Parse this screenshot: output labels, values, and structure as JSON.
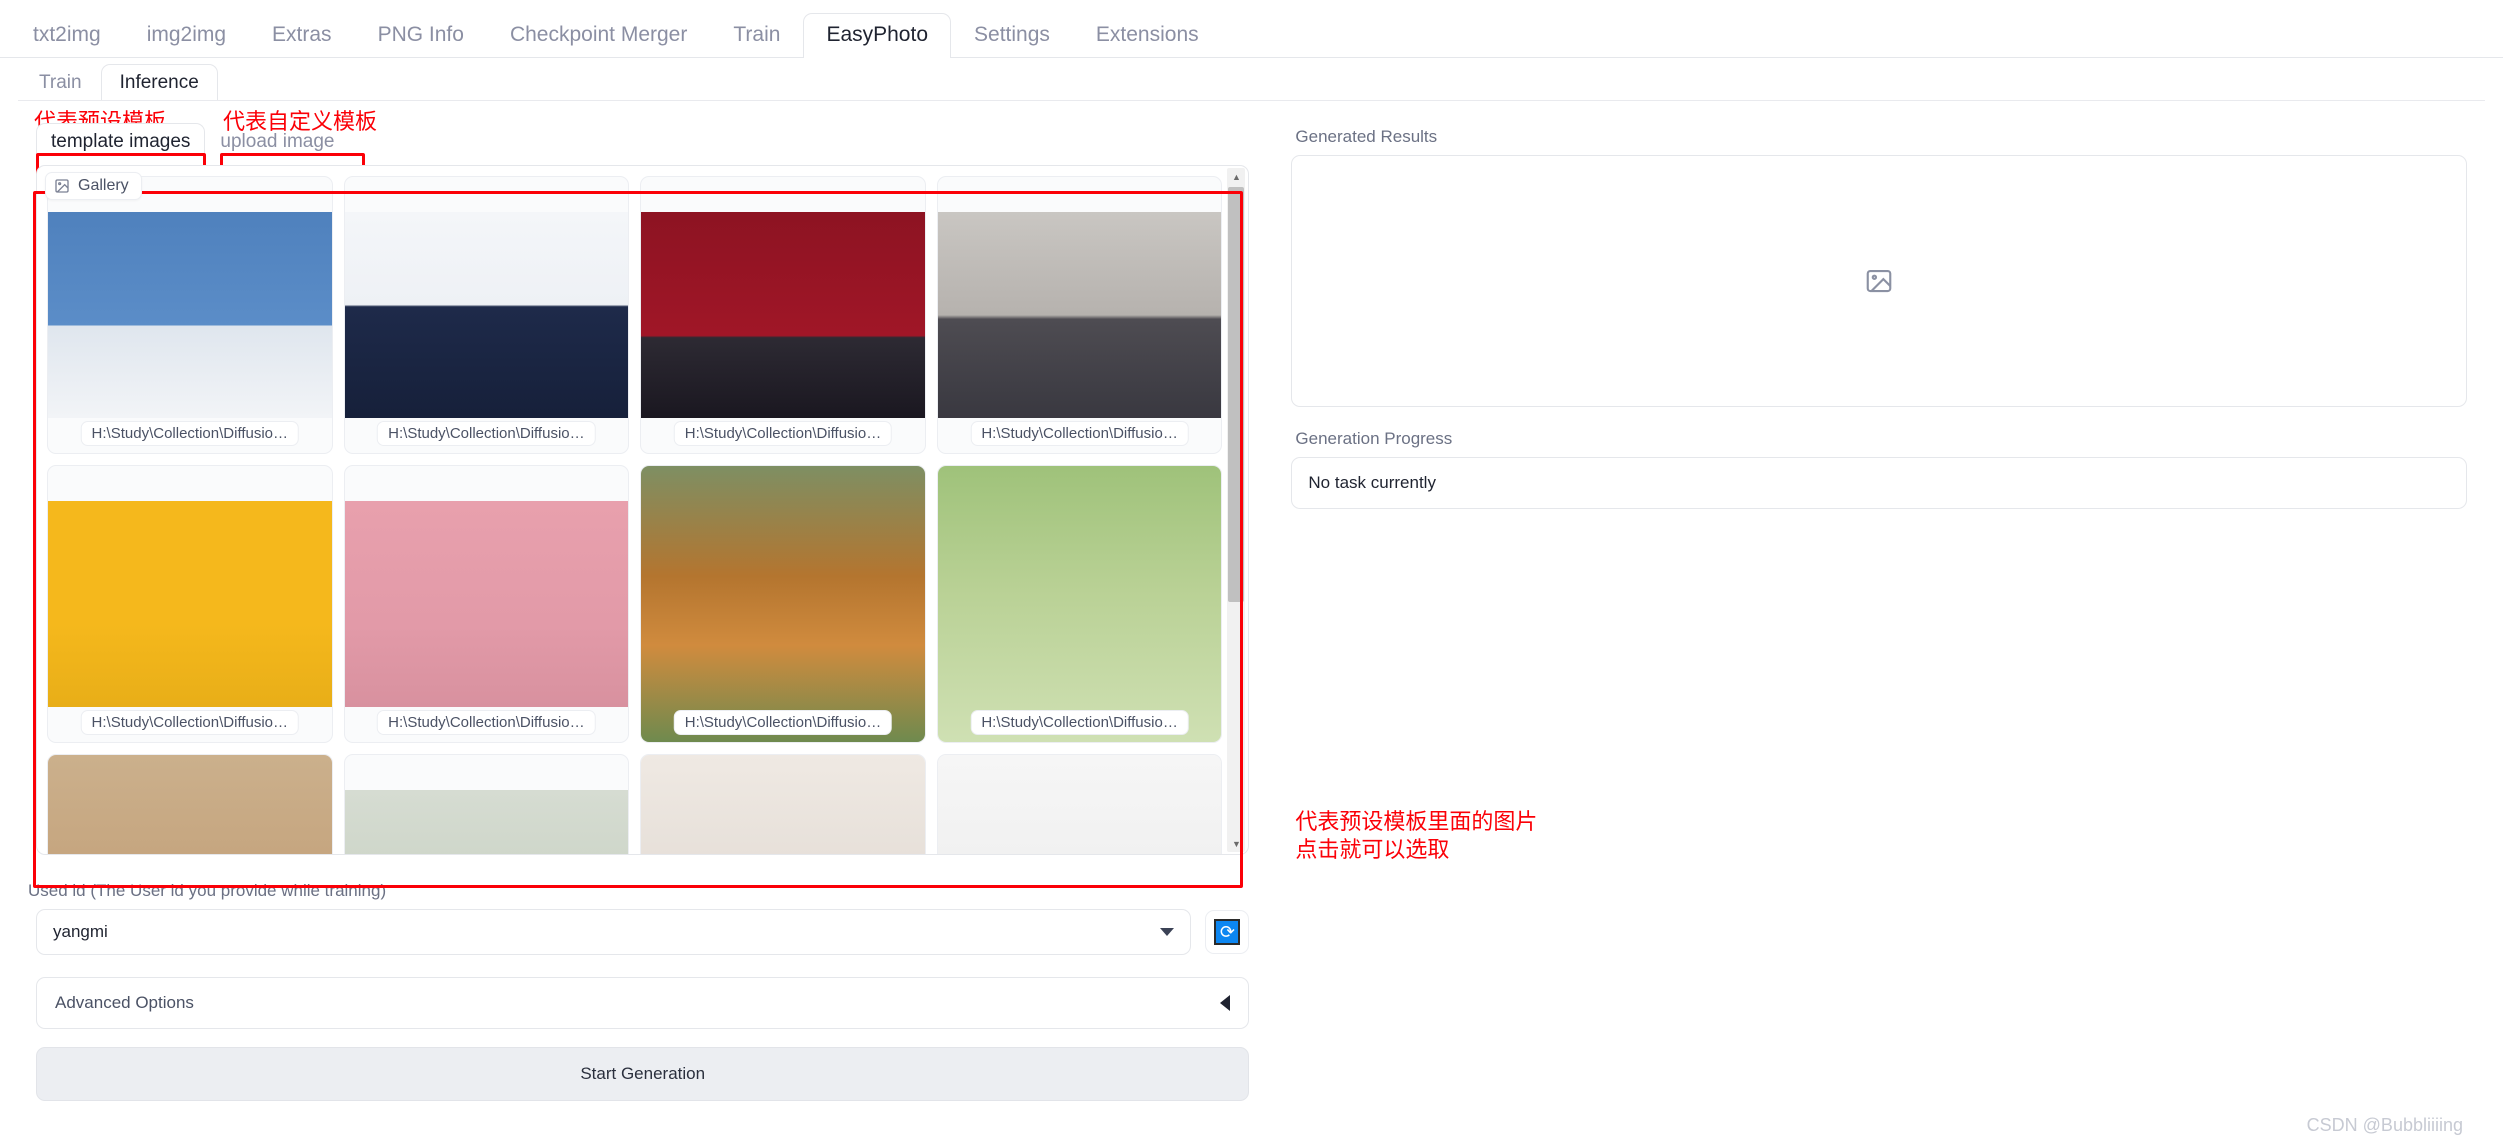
{
  "top_tabs": [
    {
      "label": "txt2img",
      "active": false
    },
    {
      "label": "img2img",
      "active": false
    },
    {
      "label": "Extras",
      "active": false
    },
    {
      "label": "PNG Info",
      "active": false
    },
    {
      "label": "Checkpoint Merger",
      "active": false
    },
    {
      "label": "Train",
      "active": false
    },
    {
      "label": "EasyPhoto",
      "active": true
    },
    {
      "label": "Settings",
      "active": false
    },
    {
      "label": "Extensions",
      "active": false
    }
  ],
  "sub_tabs": [
    {
      "label": "Train",
      "active": false
    },
    {
      "label": "Inference",
      "active": true
    }
  ],
  "template_tabs": [
    {
      "label": "template images",
      "active": true
    },
    {
      "label": "upload image",
      "active": false
    }
  ],
  "annotations": {
    "preset_template": "代表预设模板",
    "custom_template": "代表自定义模板",
    "gallery_note": "代表预设模板里面的图片\n点击就可以选取"
  },
  "gallery": {
    "badge_label": "Gallery",
    "badge_icon": "image-icon",
    "caption": "H:\\Study\\Collection\\Diffusio…",
    "items": [
      {
        "caption": "H:\\Study\\Collection\\Diffusio…",
        "style": "bg-blue-male"
      },
      {
        "caption": "H:\\Study\\Collection\\Diffusio…",
        "style": "bg-white-suit"
      },
      {
        "caption": "H:\\Study\\Collection\\Diffusio…",
        "style": "bg-red-girl"
      },
      {
        "caption": "H:\\Study\\Collection\\Diffusio…",
        "style": "bg-gray-uniform"
      },
      {
        "caption": "H:\\Study\\Collection\\Diffusio…",
        "style": "bg-yellow-hat"
      },
      {
        "caption": "H:\\Study\\Collection\\Diffusio…",
        "style": "bg-pink-dress"
      },
      {
        "caption": "H:\\Study\\Collection\\Diffusio…",
        "style": "bg-green-redhair"
      },
      {
        "caption": "H:\\Study\\Collection\\Diffusio…",
        "style": "bg-green-flower"
      },
      {
        "caption": "",
        "style": "bg-room-girl"
      },
      {
        "caption": "",
        "style": "bg-garden-girl"
      },
      {
        "caption": "",
        "style": "bg-white-longhair"
      },
      {
        "caption": "",
        "style": "bg-white-man"
      }
    ],
    "scrollbar": {
      "up_arrow": "▲",
      "down_arrow": "▼"
    }
  },
  "user_id": {
    "label": "Used id (The User id you provide while training)",
    "value": "yangmi",
    "refresh_icon": "refresh-icon",
    "refresh_glyph": "⟳"
  },
  "advanced": {
    "label": "Advanced Options",
    "caret": "caret-left-icon"
  },
  "start_button": {
    "label": "Start Generation"
  },
  "results": {
    "label": "Generated Results",
    "placeholder_icon": "image-placeholder-icon"
  },
  "progress": {
    "label": "Generation Progress",
    "value": "No task currently"
  },
  "watermark": "CSDN @Bubbliiiing",
  "colors": {
    "annotation_red": "#fb0007",
    "accent_blue": "#0c86f1",
    "border": "#e5e7eb",
    "muted_text": "#8b8fa3"
  }
}
